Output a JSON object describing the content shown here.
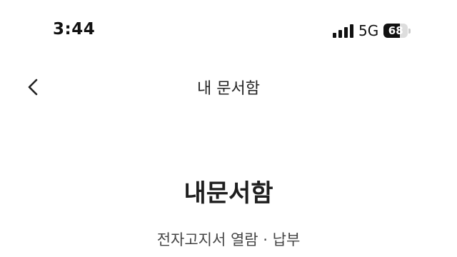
{
  "status_bar": {
    "time": "3:44",
    "network": "5G",
    "battery": "68",
    "battery_level_percent": 68
  },
  "nav": {
    "back_icon": "chevron-left-icon",
    "title": "내 문서함"
  },
  "content": {
    "title": "내문서함",
    "subtitle": "전자고지서 열람 · 납부"
  }
}
